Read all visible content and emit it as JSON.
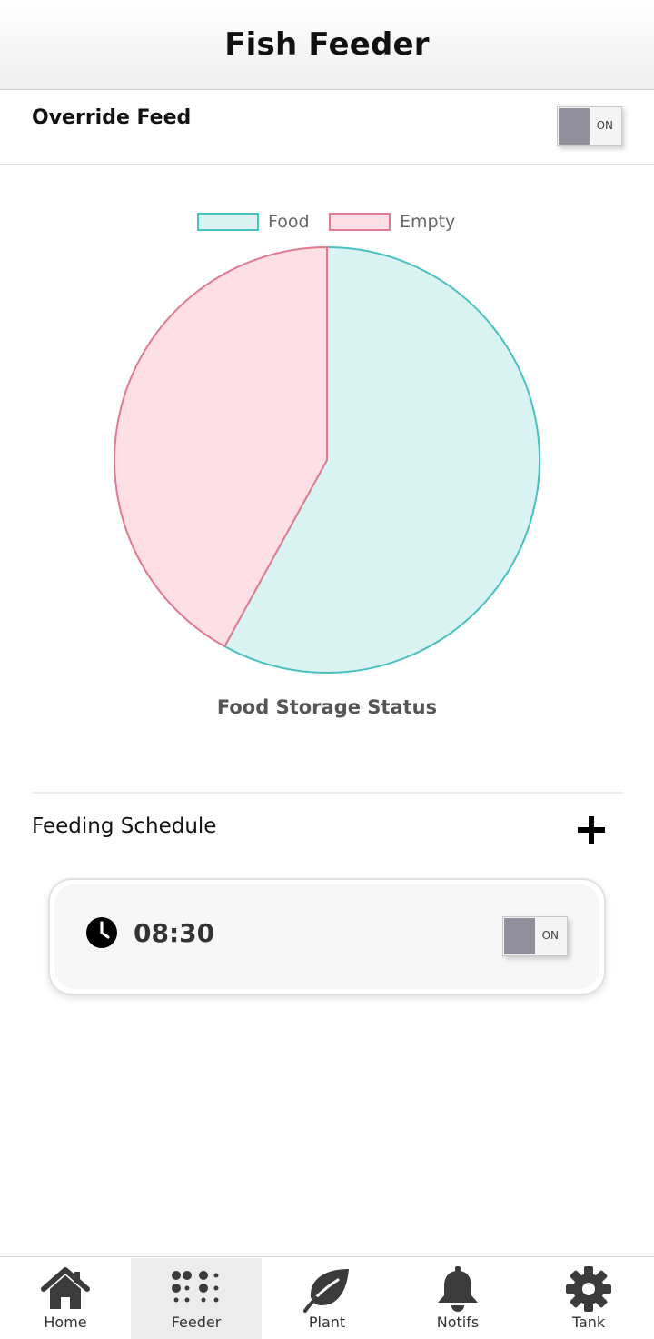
{
  "header": {
    "title": "Fish Feeder"
  },
  "override": {
    "label": "Override Feed",
    "toggle_text": "ON"
  },
  "chart_data": {
    "type": "pie",
    "title": "Food Storage Status",
    "labels": [
      "Food",
      "Empty"
    ],
    "values": [
      58,
      42
    ],
    "colors": {
      "food_fill": "#d9f2f2",
      "food_border": "#4bc0c0",
      "empty_fill": "#ffdfe6",
      "empty_border": "#e07a8f"
    },
    "legend": "top"
  },
  "schedule": {
    "label": "Feeding Schedule",
    "add_icon": "plus-icon",
    "items": [
      {
        "time": "08:30",
        "toggle_text": "ON",
        "icon": "clock-icon"
      }
    ]
  },
  "nav": {
    "items": [
      {
        "label": "Home",
        "icon": "home-icon"
      },
      {
        "label": "Feeder",
        "icon": "dots-icon",
        "active": true
      },
      {
        "label": "Plant",
        "icon": "leaf-icon"
      },
      {
        "label": "Notifs",
        "icon": "bell-icon"
      },
      {
        "label": "Tank",
        "icon": "gear-icon"
      }
    ]
  }
}
